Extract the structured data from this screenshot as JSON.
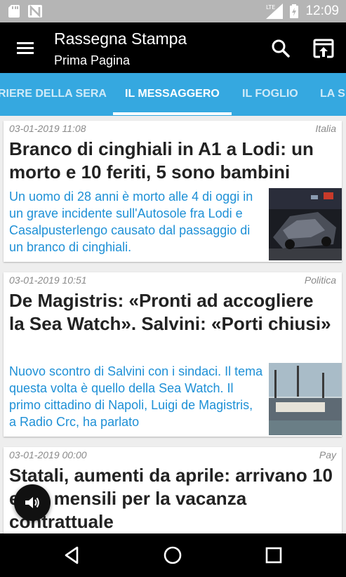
{
  "status_bar": {
    "time": "12:09",
    "network_label": "LTE",
    "icons": [
      "sd-card-icon",
      "n-notification-icon",
      "signal-icon",
      "battery-icon"
    ]
  },
  "app_bar": {
    "title": "Rassegna Stampa",
    "subtitle": "Prima Pagina",
    "icons": [
      "menu-icon",
      "search-icon",
      "open-in-browser-icon"
    ]
  },
  "tabs": [
    {
      "label": "CORRIERE DELLA SERA",
      "visible_text": "RIERE DELLA SERA"
    },
    {
      "label": "IL MESSAGGERO",
      "visible_text": "IL MESSAGGERO",
      "active": true
    },
    {
      "label": "IL FOGLIO",
      "visible_text": "IL FOGLIO"
    },
    {
      "label": "LA S",
      "visible_text": "LA S"
    }
  ],
  "articles": [
    {
      "date": "03-01-2019 11:08",
      "category": "Italia",
      "headline": "Branco di cinghiali in A1 a Lodi: un morto e 10 feriti, 5 sono bambini",
      "summary": "Un uomo di 28 anni è morto alle 4 di oggi in un grave incidente sull'Autosole fra Lodi e Casalpusterlengo causato dal passaggio di un branco di cinghiali."
    },
    {
      "date": "03-01-2019 10:51",
      "category": "Politica",
      "headline": "De Magistris: «Pronti ad accogliere la Sea Watch». Salvini: «Porti chiusi»",
      "summary": "Nuovo scontro di Salvini con i sindaci. Il tema questa volta è quello della Sea Watch. Il primo cittadino di Napoli, Luigi de Magistris, a Radio Crc, ha parlato"
    },
    {
      "date": "03-01-2019 00:00",
      "category": "Pay",
      "headline": "Statali, aumenti da aprile: arrivano 10 euro mensili per la vacanza contrattuale",
      "summary": ""
    }
  ],
  "fab": {
    "icon": "speaker-icon"
  },
  "nav_bar": {
    "icons": [
      "back-icon",
      "home-icon",
      "recents-icon"
    ]
  },
  "colors": {
    "status_bar": "#b5b5b5",
    "app_bar": "#000000",
    "tab_bar": "#35a8e0",
    "summary_text": "#1e90d6",
    "background": "#eeeeee"
  }
}
